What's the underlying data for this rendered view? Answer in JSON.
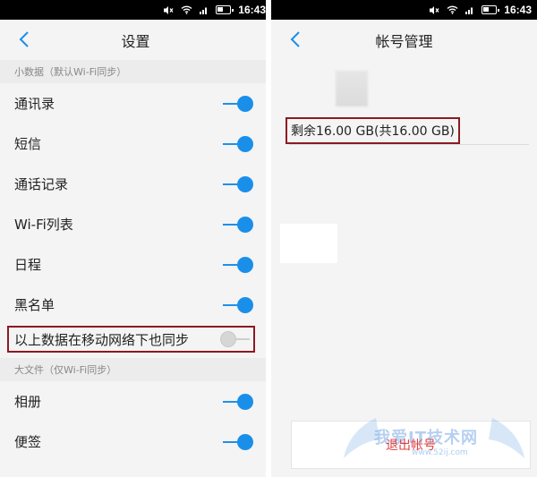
{
  "status_bar": {
    "time": "16:43"
  },
  "left_screen": {
    "title": "设置",
    "section_small_data": "小数据（默认Wi-Fi同步）",
    "rows": [
      {
        "label": "通讯录",
        "on": true
      },
      {
        "label": "短信",
        "on": true
      },
      {
        "label": "通话记录",
        "on": true
      },
      {
        "label": "Wi-Fi列表",
        "on": true
      },
      {
        "label": "日程",
        "on": true
      },
      {
        "label": "黑名单",
        "on": true
      }
    ],
    "mobile_sync": {
      "label": "以上数据在移动网络下也同步",
      "on": false
    },
    "section_large_files": "大文件（仅Wi-Fi同步）",
    "large_rows": [
      {
        "label": "相册",
        "on": true
      },
      {
        "label": "便签",
        "on": true
      }
    ]
  },
  "right_screen": {
    "title": "帐号管理",
    "storage_text": "剩余16.00 GB(共16.00 GB)",
    "logout_label": "退出帐号"
  },
  "watermark": {
    "text": "我爱IT技术网",
    "url": "www.52ij.com"
  },
  "colors": {
    "accent": "#1a8fea",
    "highlight_border": "#8b1a22",
    "logout_red": "#e04040"
  }
}
